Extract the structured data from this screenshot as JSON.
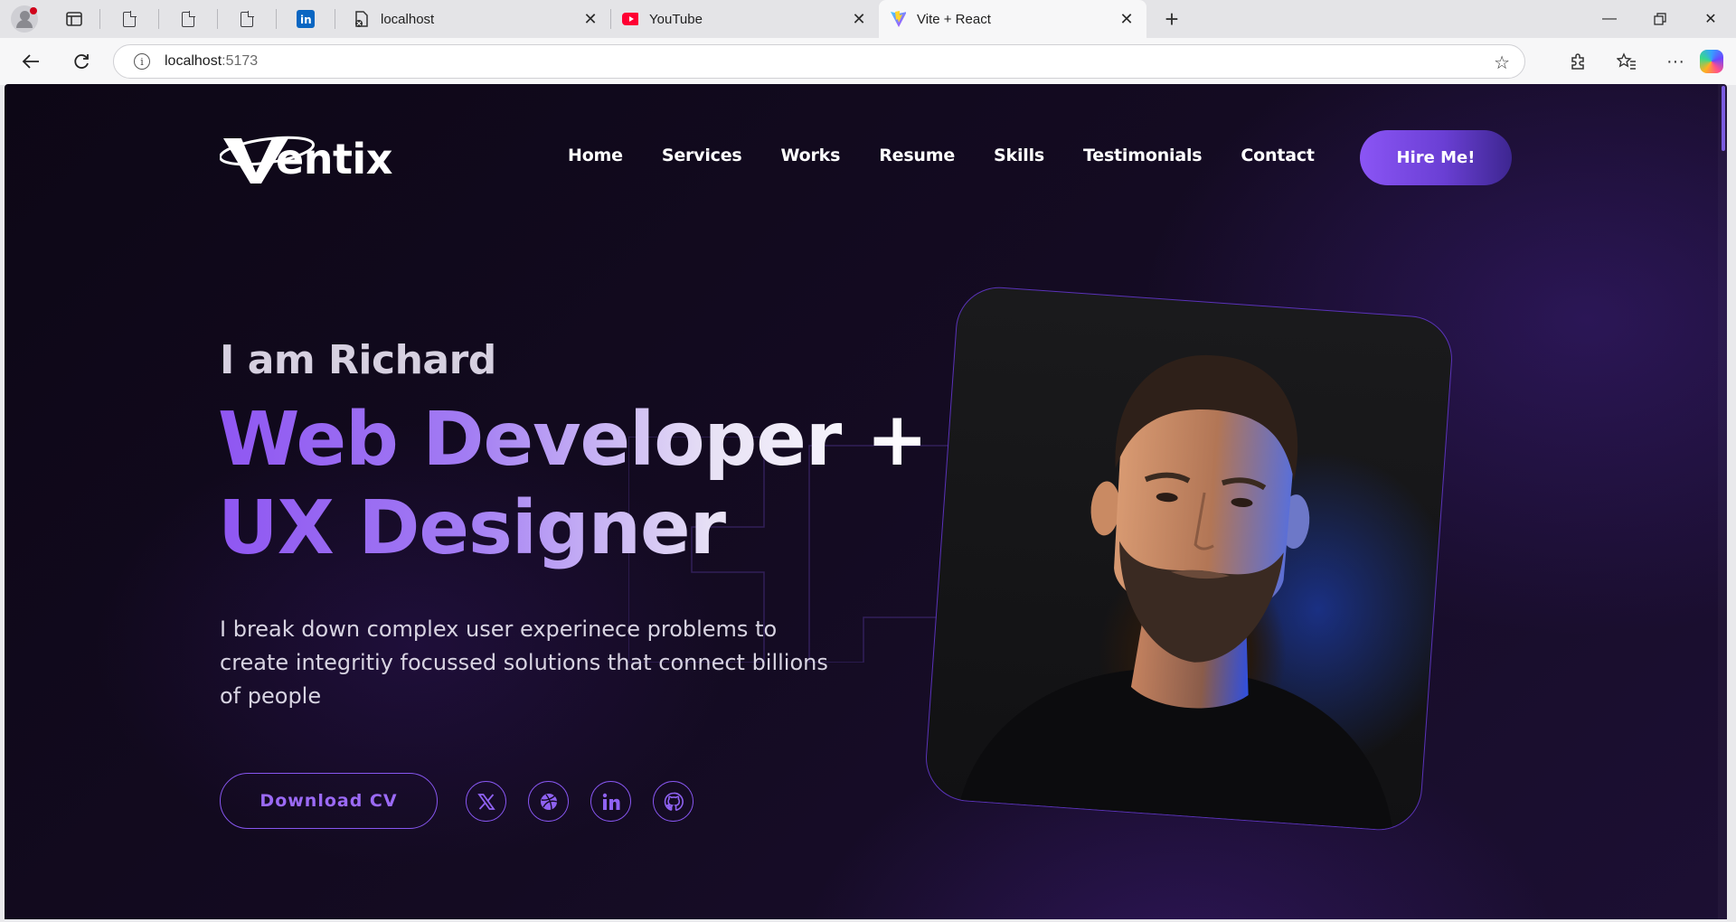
{
  "browser": {
    "tabs": [
      {
        "title": "localhost",
        "icon": "doc-error-icon"
      },
      {
        "title": "YouTube",
        "icon": "youtube-icon"
      },
      {
        "title": "Vite + React",
        "icon": "vite-icon",
        "active": true
      }
    ],
    "address": {
      "host": "localhost",
      "port": ":5173"
    }
  },
  "site": {
    "logo": "Ventix",
    "nav": [
      "Home",
      "Services",
      "Works",
      "Resume",
      "Skills",
      "Testimonials",
      "Contact"
    ],
    "cta": "Hire Me!",
    "greeting": "I am Richard",
    "headline_line1": "Web Developer +",
    "headline_line2": "UX Designer",
    "description": "I break down complex user experinece problems to create integritiy focussed solutions that connect billions of people",
    "download_label": "Download CV",
    "socials": [
      "x-icon",
      "dribbble-icon",
      "linkedin-icon",
      "github-icon"
    ],
    "colors": {
      "accent": "#8756f0",
      "background": "#140b22"
    }
  }
}
